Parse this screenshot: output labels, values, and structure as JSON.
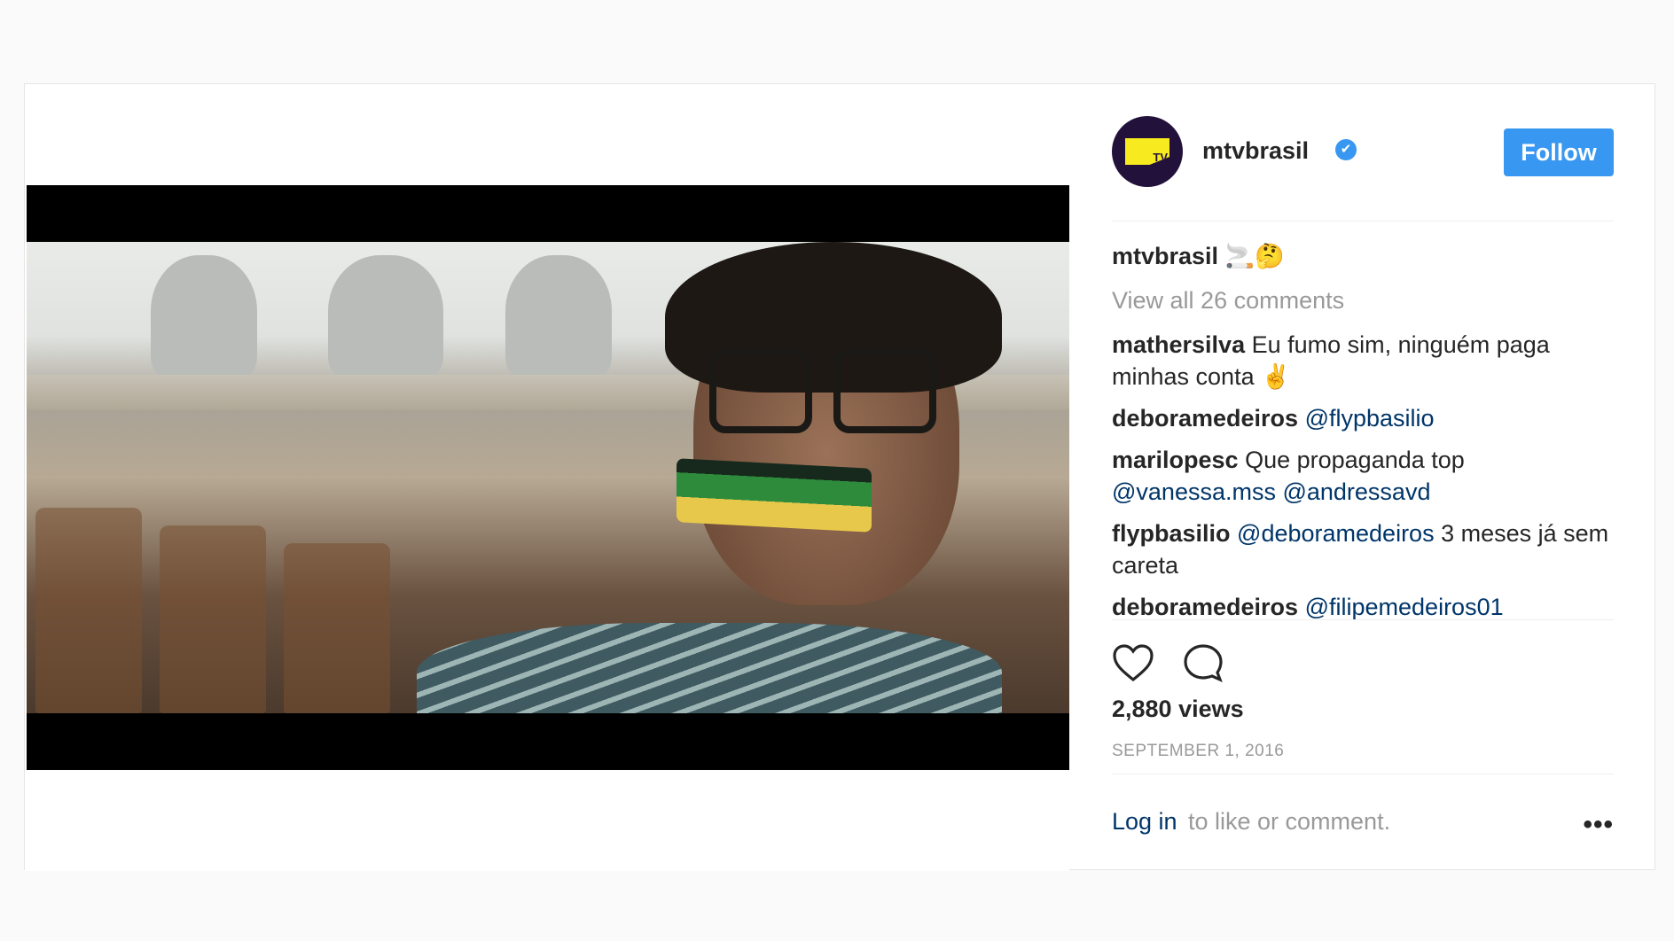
{
  "account": {
    "username": "mtvbrasil",
    "verified_icon": "✔",
    "avatar_logo_text": "TV",
    "follow_label": "Follow",
    "follow_color": "#3897f0"
  },
  "caption": {
    "username": "mtvbrasil",
    "text": "🚬🤔"
  },
  "view_all_comments": "View all 26 comments",
  "comments": [
    {
      "user": "mathersilva",
      "text": "Eu fumo sim, ninguém paga minhas conta ✌️"
    },
    {
      "user": "deboramedeiros",
      "mention": "@flypbasilio"
    },
    {
      "user": "marilopesc",
      "text": "Que propaganda top",
      "mention": "@vanessa.mss @andressavd"
    },
    {
      "user": "flypbasilio",
      "mention": "@deboramedeiros",
      "text": "3 meses já sem careta"
    },
    {
      "user": "deboramedeiros",
      "mention": "@filipemedeiros01"
    }
  ],
  "actions": {
    "like_icon": "heart-icon",
    "comment_icon": "comment-icon"
  },
  "views": "2,880 views",
  "date": "SEPTEMBER 1, 2016",
  "login": {
    "link": "Log in",
    "rest": "to like or comment.",
    "more": "•••"
  }
}
